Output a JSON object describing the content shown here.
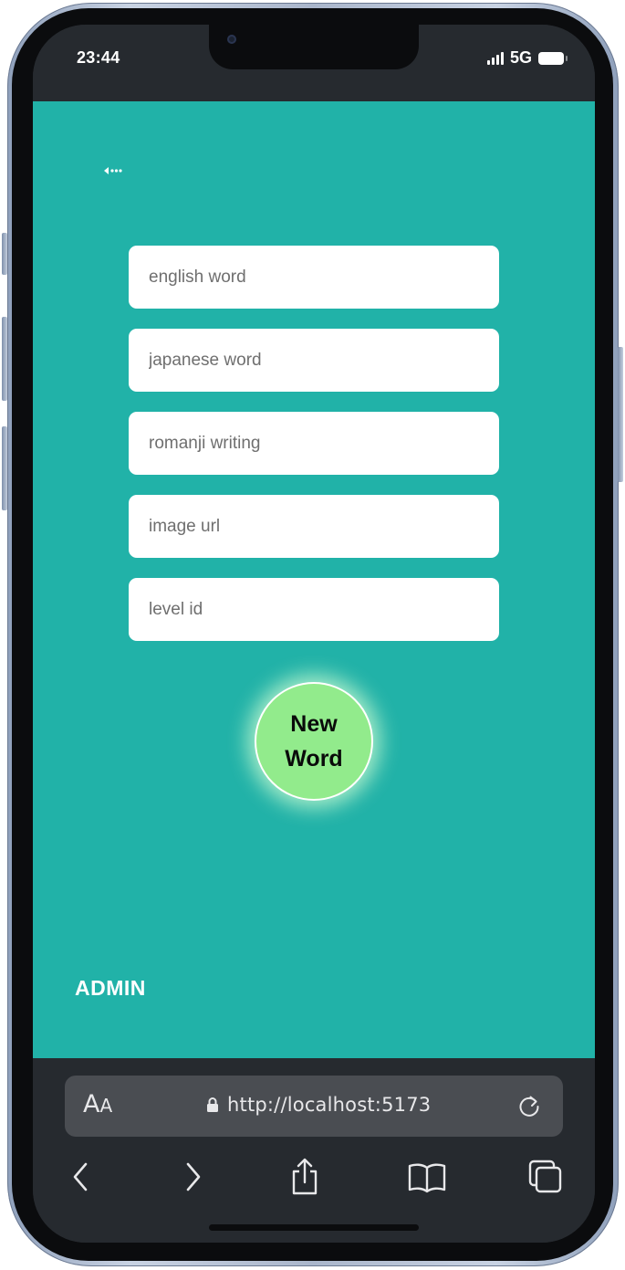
{
  "status_bar": {
    "time": "23:44",
    "network": "5G"
  },
  "icons": {
    "back": "back-arrow-icon",
    "signal": "signal-icon",
    "battery": "battery-icon",
    "lock": "lock-icon",
    "reload": "reload-icon",
    "nav_back": "chevron-left-icon",
    "nav_forward": "chevron-right-icon",
    "share": "share-icon",
    "bookmarks": "book-icon",
    "tabs": "tabs-icon"
  },
  "form": {
    "fields": [
      {
        "name": "english-word-input",
        "placeholder": "english word",
        "value": ""
      },
      {
        "name": "japanese-word-input",
        "placeholder": "japanese word",
        "value": ""
      },
      {
        "name": "romanji-writing-input",
        "placeholder": "romanji writing",
        "value": ""
      },
      {
        "name": "image-url-input",
        "placeholder": "image url",
        "value": ""
      },
      {
        "name": "level-id-input",
        "placeholder": "level id",
        "value": ""
      }
    ],
    "submit_label_line1": "New",
    "submit_label_line2": "Word"
  },
  "footer": {
    "admin_label": "ADMIN"
  },
  "browser": {
    "text_size_big": "A",
    "text_size_small": "A",
    "url": "http://localhost:5173"
  },
  "colors": {
    "page_background": "#21b2a8",
    "button_fill": "#92eb8c",
    "browser_chrome": "#262a2f",
    "url_bar": "#4a4d52"
  }
}
